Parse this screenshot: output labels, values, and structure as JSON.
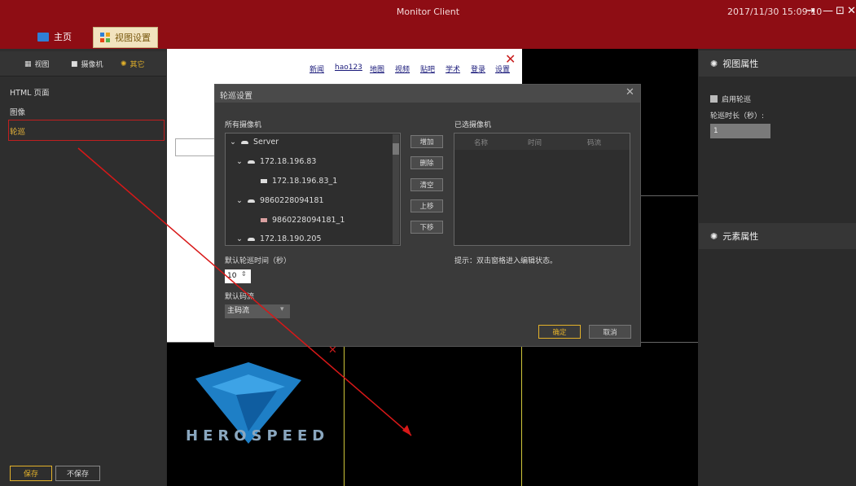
{
  "window": {
    "title": "Monitor Client",
    "datetime": "2017/11/30 15:09:10",
    "controls": [
      "⇥",
      "—",
      "⊡",
      "✕"
    ]
  },
  "nav": {
    "home": "主页",
    "view_settings": "视图设置"
  },
  "left": {
    "tabs": [
      "视图",
      "摄像机",
      "其它"
    ],
    "items": [
      "HTML 页面",
      "图像",
      "轮巡"
    ],
    "save": "保存",
    "nosave": "不保存"
  },
  "browser": {
    "links": [
      "新闻",
      "hao123",
      "地图",
      "视频",
      "贴吧",
      "学术",
      "登录",
      "设置"
    ]
  },
  "brand": {
    "logo_text": "HEROSPEED"
  },
  "right": {
    "view_props": "视图属性",
    "enable_tour": "启用轮巡",
    "tour_duration_label": "轮巡时长（秒）:",
    "tour_duration_value": "1",
    "element_props": "元素属性"
  },
  "dialog": {
    "title": "轮巡设置",
    "all_cameras": "所有摄像机",
    "selected_cameras": "已选摄像机",
    "tree": [
      {
        "label": "Server",
        "level": 0,
        "icon": "server-icon"
      },
      {
        "label": "172.18.196.83",
        "level": 1,
        "icon": "server-icon"
      },
      {
        "label": "172.18.196.83_1",
        "level": 2,
        "icon": "camera-icon"
      },
      {
        "label": "9860228094181",
        "level": 1,
        "icon": "server-icon"
      },
      {
        "label": "9860228094181_1",
        "level": 2,
        "icon": "camera-icon"
      },
      {
        "label": "172.18.190.205",
        "level": 1,
        "icon": "server-icon"
      }
    ],
    "buttons": [
      "增加",
      "删除",
      "清空",
      "上移",
      "下移"
    ],
    "columns": [
      "名称",
      "时间",
      "码流"
    ],
    "default_time_label": "默认轮巡时间（秒）",
    "default_time_value": "10",
    "default_stream_label": "默认码流",
    "default_stream_value": "主码流",
    "hint": "提示：双击窗格进入编辑状态。",
    "ok": "确定",
    "cancel": "取消"
  },
  "colors": {
    "titlebar": "#8e0d14",
    "accent": "#e3b12a",
    "highlight_box": "#c01f1f"
  }
}
